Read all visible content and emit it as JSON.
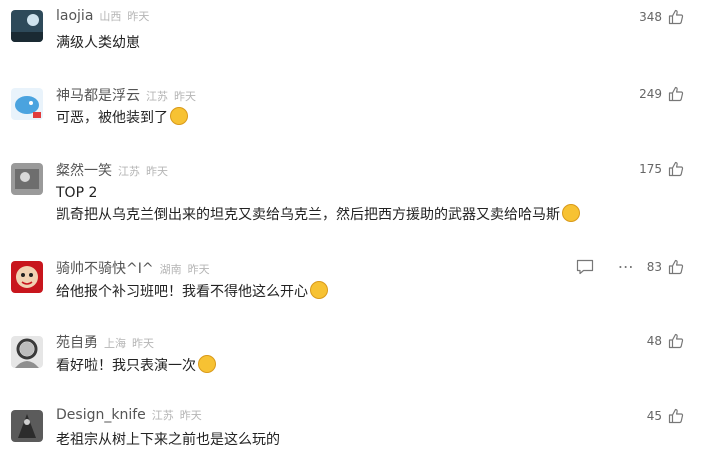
{
  "comments": [
    {
      "name": "laojia",
      "location": "山西",
      "time": "昨天",
      "text": "满级人类幼崽",
      "likes": "348"
    },
    {
      "name": "神马都是浮云",
      "location": "江苏",
      "time": "昨天",
      "text": "可恶，被他装到了",
      "likes": "249"
    },
    {
      "name": "粲然一笑",
      "location": "江苏",
      "time": "昨天",
      "text": "TOP 2",
      "text2": "凯奇把从乌克兰倒出来的坦克又卖给乌克兰，然后把西方援助的武器又卖给哈马斯",
      "likes": "175"
    },
    {
      "name": "骑帅不骑快^I^",
      "location": "湖南",
      "time": "昨天",
      "text": "给他报个补习班吧！我看不得他这么开心",
      "likes": "83"
    },
    {
      "name": "苑自勇",
      "location": "上海",
      "time": "昨天",
      "text": "看好啦！我只表演一次",
      "likes": "48"
    },
    {
      "name": "Design_knife",
      "location": "江苏",
      "time": "昨天",
      "text": "老祖宗从树上下来之前也是这么玩的",
      "likes": "45"
    }
  ],
  "icons": {
    "like": "thumbs-up-icon",
    "reply": "reply-icon",
    "more": "more-icon"
  },
  "colors": {
    "text": "#222222",
    "meta": "#b5b5b5",
    "name": "#555555"
  }
}
